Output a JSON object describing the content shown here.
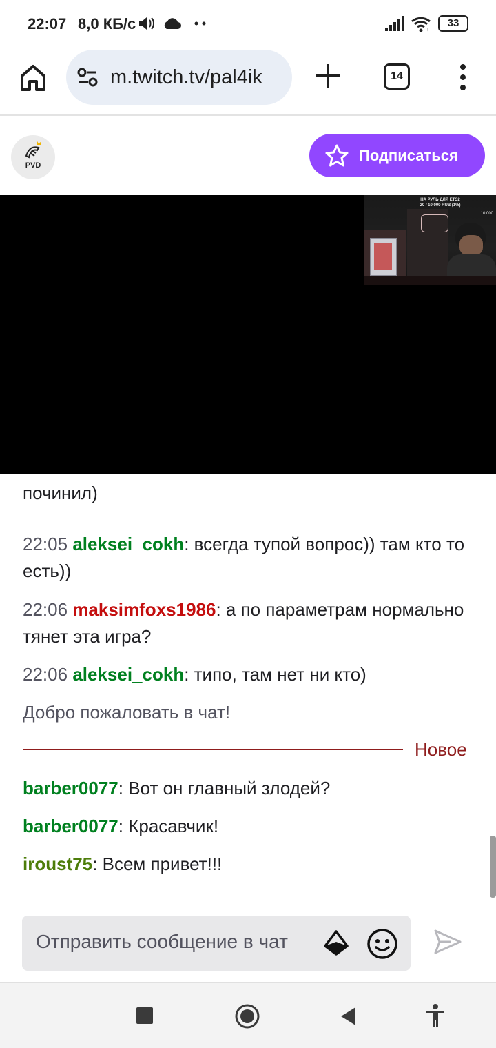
{
  "status_bar": {
    "time": "22:07",
    "speed": "8,0 КБ/с",
    "battery": "33"
  },
  "browser": {
    "url": "m.twitch.tv/pal4ik",
    "tab_count": "14"
  },
  "channel": {
    "avatar_text": "PVD",
    "subscribe_label": "Подписаться",
    "accent_color": "#9147ff"
  },
  "video": {
    "cam_caption_line1": "НА РУЛЬ ДЛЯ ETS2",
    "cam_caption_line2": "20 / 10 000 RUB (1%)",
    "cam_goal": "10 000"
  },
  "chat": {
    "partial_message_tail": "починил)",
    "messages": [
      {
        "time": "22:05",
        "user": "aleksei_cokh",
        "user_color": "#00801f",
        "text": ": всегда тупой вопрос)) там кто то есть))"
      },
      {
        "time": "22:06",
        "user": "maksimfoxs1986",
        "user_color": "#c40e0e",
        "text": ": а по параметрам нормально тянет эта игра?"
      },
      {
        "time": "22:06",
        "user": "aleksei_cokh",
        "user_color": "#00801f",
        "text": ": типо, там нет ни кто)"
      }
    ],
    "welcome": "Добро пожаловать в чат!",
    "new_divider_label": "Новое",
    "new_messages": [
      {
        "user": "barber0077",
        "user_color": "#00801f",
        "text": ": Вот он главный злодей?"
      },
      {
        "user": "barber0077",
        "user_color": "#00801f",
        "text": ": Красавчик!"
      },
      {
        "user": "iroust75",
        "user_color": "#4d7d0a",
        "text": ": Всем привет!!!"
      }
    ]
  },
  "composer": {
    "placeholder": "Отправить сообщение в чат"
  }
}
